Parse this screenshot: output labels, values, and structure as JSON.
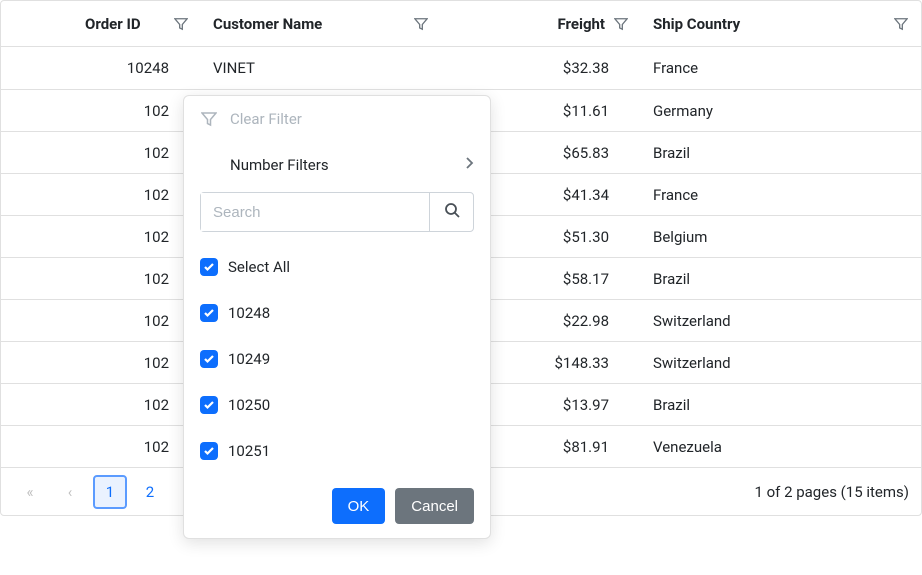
{
  "columns": {
    "order_id": "Order ID",
    "customer": "Customer Name",
    "freight": "Freight",
    "country": "Ship Country"
  },
  "rows": [
    {
      "order_id": "10248",
      "customer": "VINET",
      "freight": "$32.38",
      "country": "France"
    },
    {
      "order_id": "102",
      "customer": "",
      "freight": "$11.61",
      "country": "Germany"
    },
    {
      "order_id": "102",
      "customer": "",
      "freight": "$65.83",
      "country": "Brazil"
    },
    {
      "order_id": "102",
      "customer": "",
      "freight": "$41.34",
      "country": "France"
    },
    {
      "order_id": "102",
      "customer": "",
      "freight": "$51.30",
      "country": "Belgium"
    },
    {
      "order_id": "102",
      "customer": "",
      "freight": "$58.17",
      "country": "Brazil"
    },
    {
      "order_id": "102",
      "customer": "",
      "freight": "$22.98",
      "country": "Switzerland"
    },
    {
      "order_id": "102",
      "customer": "",
      "freight": "$148.33",
      "country": "Switzerland"
    },
    {
      "order_id": "102",
      "customer": "",
      "freight": "$13.97",
      "country": "Brazil"
    },
    {
      "order_id": "102",
      "customer": "",
      "freight": "$81.91",
      "country": "Venezuela"
    }
  ],
  "pager": {
    "page1": "1",
    "page2": "2",
    "info": "1 of 2 pages (15 items)"
  },
  "filter_popup": {
    "clear": "Clear Filter",
    "number_filters": "Number Filters",
    "search_placeholder": "Search",
    "select_all": "Select All",
    "options": [
      "10248",
      "10249",
      "10250",
      "10251"
    ],
    "ok": "OK",
    "cancel": "Cancel"
  }
}
